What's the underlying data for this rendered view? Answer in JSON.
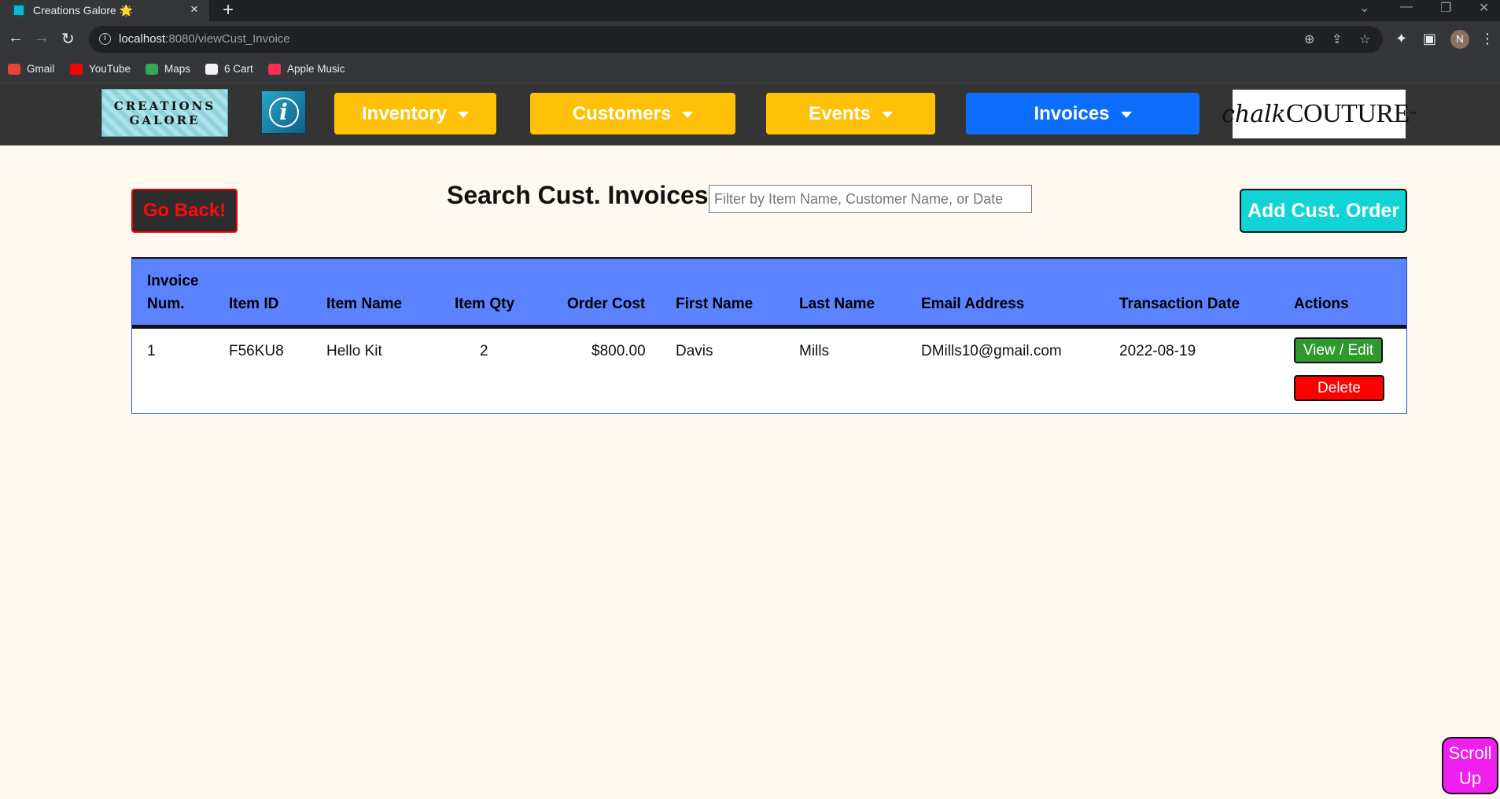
{
  "browser": {
    "tab_title": "Creations Galore 🌟",
    "url_host": "localhost",
    "url_rest": ":8080/viewCust_Invoice",
    "profile_initial": "N",
    "bookmarks": [
      {
        "label": "Gmail",
        "icon": "gmail-icon",
        "color": "#ea4335"
      },
      {
        "label": "YouTube",
        "icon": "youtube-icon",
        "color": "#ff0000"
      },
      {
        "label": "Maps",
        "icon": "maps-icon",
        "color": "#34a853"
      },
      {
        "label": "6 Cart",
        "icon": "amazon-icon",
        "color": "#f2f2f2"
      },
      {
        "label": "Apple Music",
        "icon": "apple-music-icon",
        "color": "#fa2d55"
      }
    ]
  },
  "nav": {
    "logo_line1": "CREATIONS",
    "logo_line2": "GALORE",
    "info_glyph": "i",
    "inventory": "Inventory",
    "customers": "Customers",
    "events": "Events",
    "invoices": "Invoices",
    "brand_script": "chalk",
    "brand_caps": "COUTURE",
    "brand_tm": "™",
    "colors": {
      "menu": "#ffc107",
      "active": "#0d6efd",
      "bar": "#343434"
    }
  },
  "page": {
    "go_back": "Go Back!",
    "search_label": "Search Cust. Invoices:",
    "search_placeholder": "Filter by Item Name, Customer Name, or Date",
    "search_value": "",
    "add_order": "Add Cust. Order",
    "scroll_up": "Scroll Up"
  },
  "table": {
    "headers": {
      "invoice_num_1": "Invoice",
      "invoice_num_2": "Num.",
      "item_id": "Item ID",
      "item_name": "Item Name",
      "item_qty": "Item Qty",
      "order_cost": "Order Cost",
      "first_name": "First Name",
      "last_name": "Last Name",
      "email": "Email Address",
      "transaction_date": "Transaction Date",
      "actions": "Actions"
    },
    "rows": [
      {
        "invoice_num": "1",
        "item_id": "F56KU8",
        "item_name": "Hello Kit",
        "item_qty": "2",
        "order_cost": "$800.00",
        "first_name": "Davis",
        "last_name": "Mills",
        "email": "DMills10@gmail.com",
        "transaction_date": "2022-08-19",
        "view_edit": "View / Edit",
        "delete": "Delete"
      }
    ]
  }
}
